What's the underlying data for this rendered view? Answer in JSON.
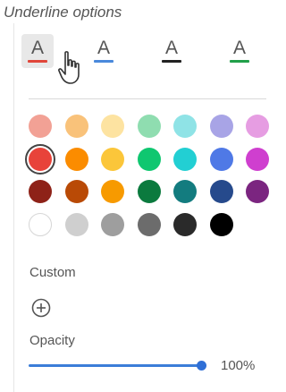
{
  "caption": "Underline options",
  "underline_options": [
    {
      "letter": "A",
      "underline_color": "#e0463a",
      "selected": true
    },
    {
      "letter": "A",
      "underline_color": "#4a89dc",
      "selected": false
    },
    {
      "letter": "A",
      "underline_color": "#222222",
      "selected": false
    },
    {
      "letter": "A",
      "underline_color": "#22a04a",
      "selected": false
    }
  ],
  "palette": [
    [
      "#f2a195",
      "#f9c27a",
      "#fde3a1",
      "#8fddb0",
      "#8fe3e6",
      "#a8a4e6",
      "#e69de2"
    ],
    [
      "#e8433a",
      "#fb8c00",
      "#fbc63a",
      "#0fc770",
      "#22cfd3",
      "#4f79e6",
      "#cf3fcf"
    ],
    [
      "#8e2218",
      "#b94a06",
      "#f79a00",
      "#0b7a3e",
      "#137c7f",
      "#264a8c",
      "#7b2580"
    ],
    [
      "#ffffff",
      "#cfcfcf",
      "#9e9e9e",
      "#6c6c6c",
      "#2a2a2a",
      "#000000"
    ]
  ],
  "selected_color": "#e8433a",
  "custom_label": "Custom",
  "add_icon": "plus-circle-icon",
  "opacity_label": "Opacity",
  "opacity_value": "100%",
  "opacity_fraction": 1.0,
  "accent_color": "#3b7dd8"
}
